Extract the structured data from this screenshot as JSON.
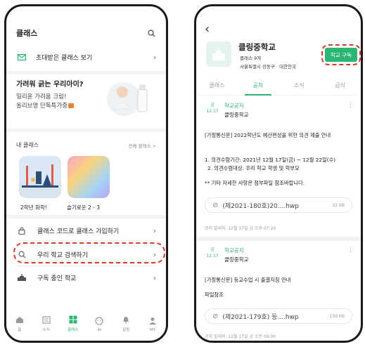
{
  "left": {
    "header": {
      "title": "클래스"
    },
    "invite_label": "초대받은 클래스 보기",
    "banner": {
      "title": "가려워 긁는 우리아이?",
      "line1": "일리윤 가려움 크림!",
      "line2": "올리브영 단독특가중"
    },
    "my_classes": {
      "heading": "내 클래스",
      "all_link": "전체 클래스 >",
      "items": [
        {
          "label": "2학년 화학!"
        },
        {
          "label": "슬기로운 2 - 3"
        }
      ]
    },
    "menu": [
      {
        "label": "클래스 코드로 클래스 가입하기"
      },
      {
        "label": "우리 학교 검색하기"
      },
      {
        "label": "구독 중인 학교"
      }
    ],
    "tabbar": [
      {
        "label": "홈"
      },
      {
        "label": "소식"
      },
      {
        "label": "클래스"
      },
      {
        "label": "AI"
      },
      {
        "label": "알림"
      },
      {
        "label": "MY"
      }
    ]
  },
  "right": {
    "school": {
      "name": "클링중학교",
      "meta": "클래스 9개",
      "address": "서울특별시 강동구 · 대한민국",
      "subscribe_label": "학교 구독"
    },
    "tabs": [
      {
        "label": "클래스"
      },
      {
        "label": "공지"
      },
      {
        "label": "소식"
      },
      {
        "label": "급식"
      }
    ],
    "posts": [
      {
        "month": "금",
        "date": "12.17",
        "category": "학교공지",
        "school": "클링중학교",
        "title": "[가정통신문] 2022학년도 예산편성을 위한 의견 제출 안내",
        "line1": "1. 의견수렴기간: 2021년 12월 17일(금) ~ 12월 22일(수)",
        "line2": "2. 의견수렴대상: 우리 학교 학생 및 학부모",
        "note": "** 기타 자세한 사항은 첨부파일 참조바랍니다.",
        "file_name": "(제2021-180호)20....hwp",
        "file_size": "32 KB",
        "footer": "공지 알리미, 12월 17일 금 오후 07:20"
      },
      {
        "month": "금",
        "date": "12.17",
        "category": "학교공지",
        "school": "클링중학교",
        "title": "[가정통신문] 등교수업 시 출결지침 안내",
        "line1": "파일참조",
        "file_name": "(제2021-179호) 등....hwp",
        "file_size": "109 KB",
        "footer": "공지 알리미, 12월 17일 금 오전 09:00"
      }
    ]
  },
  "colors": {
    "accent": "#2bb673",
    "highlight": "#d63a2a"
  }
}
